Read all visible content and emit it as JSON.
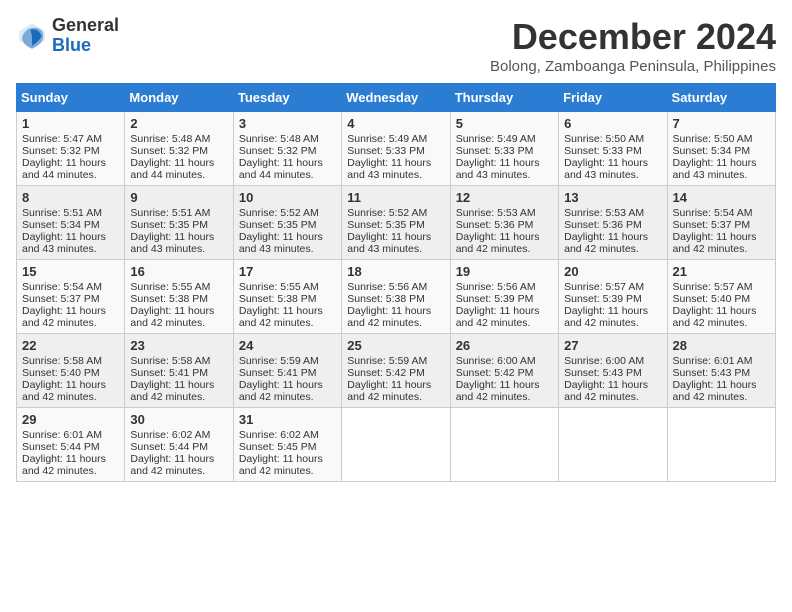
{
  "logo": {
    "general": "General",
    "blue": "Blue"
  },
  "title": "December 2024",
  "location": "Bolong, Zamboanga Peninsula, Philippines",
  "days_header": [
    "Sunday",
    "Monday",
    "Tuesday",
    "Wednesday",
    "Thursday",
    "Friday",
    "Saturday"
  ],
  "weeks": [
    [
      {
        "day": "1",
        "sunrise": "Sunrise: 5:47 AM",
        "sunset": "Sunset: 5:32 PM",
        "daylight": "Daylight: 11 hours and 44 minutes."
      },
      {
        "day": "2",
        "sunrise": "Sunrise: 5:48 AM",
        "sunset": "Sunset: 5:32 PM",
        "daylight": "Daylight: 11 hours and 44 minutes."
      },
      {
        "day": "3",
        "sunrise": "Sunrise: 5:48 AM",
        "sunset": "Sunset: 5:32 PM",
        "daylight": "Daylight: 11 hours and 44 minutes."
      },
      {
        "day": "4",
        "sunrise": "Sunrise: 5:49 AM",
        "sunset": "Sunset: 5:33 PM",
        "daylight": "Daylight: 11 hours and 43 minutes."
      },
      {
        "day": "5",
        "sunrise": "Sunrise: 5:49 AM",
        "sunset": "Sunset: 5:33 PM",
        "daylight": "Daylight: 11 hours and 43 minutes."
      },
      {
        "day": "6",
        "sunrise": "Sunrise: 5:50 AM",
        "sunset": "Sunset: 5:33 PM",
        "daylight": "Daylight: 11 hours and 43 minutes."
      },
      {
        "day": "7",
        "sunrise": "Sunrise: 5:50 AM",
        "sunset": "Sunset: 5:34 PM",
        "daylight": "Daylight: 11 hours and 43 minutes."
      }
    ],
    [
      {
        "day": "8",
        "sunrise": "Sunrise: 5:51 AM",
        "sunset": "Sunset: 5:34 PM",
        "daylight": "Daylight: 11 hours and 43 minutes."
      },
      {
        "day": "9",
        "sunrise": "Sunrise: 5:51 AM",
        "sunset": "Sunset: 5:35 PM",
        "daylight": "Daylight: 11 hours and 43 minutes."
      },
      {
        "day": "10",
        "sunrise": "Sunrise: 5:52 AM",
        "sunset": "Sunset: 5:35 PM",
        "daylight": "Daylight: 11 hours and 43 minutes."
      },
      {
        "day": "11",
        "sunrise": "Sunrise: 5:52 AM",
        "sunset": "Sunset: 5:35 PM",
        "daylight": "Daylight: 11 hours and 43 minutes."
      },
      {
        "day": "12",
        "sunrise": "Sunrise: 5:53 AM",
        "sunset": "Sunset: 5:36 PM",
        "daylight": "Daylight: 11 hours and 42 minutes."
      },
      {
        "day": "13",
        "sunrise": "Sunrise: 5:53 AM",
        "sunset": "Sunset: 5:36 PM",
        "daylight": "Daylight: 11 hours and 42 minutes."
      },
      {
        "day": "14",
        "sunrise": "Sunrise: 5:54 AM",
        "sunset": "Sunset: 5:37 PM",
        "daylight": "Daylight: 11 hours and 42 minutes."
      }
    ],
    [
      {
        "day": "15",
        "sunrise": "Sunrise: 5:54 AM",
        "sunset": "Sunset: 5:37 PM",
        "daylight": "Daylight: 11 hours and 42 minutes."
      },
      {
        "day": "16",
        "sunrise": "Sunrise: 5:55 AM",
        "sunset": "Sunset: 5:38 PM",
        "daylight": "Daylight: 11 hours and 42 minutes."
      },
      {
        "day": "17",
        "sunrise": "Sunrise: 5:55 AM",
        "sunset": "Sunset: 5:38 PM",
        "daylight": "Daylight: 11 hours and 42 minutes."
      },
      {
        "day": "18",
        "sunrise": "Sunrise: 5:56 AM",
        "sunset": "Sunset: 5:38 PM",
        "daylight": "Daylight: 11 hours and 42 minutes."
      },
      {
        "day": "19",
        "sunrise": "Sunrise: 5:56 AM",
        "sunset": "Sunset: 5:39 PM",
        "daylight": "Daylight: 11 hours and 42 minutes."
      },
      {
        "day": "20",
        "sunrise": "Sunrise: 5:57 AM",
        "sunset": "Sunset: 5:39 PM",
        "daylight": "Daylight: 11 hours and 42 minutes."
      },
      {
        "day": "21",
        "sunrise": "Sunrise: 5:57 AM",
        "sunset": "Sunset: 5:40 PM",
        "daylight": "Daylight: 11 hours and 42 minutes."
      }
    ],
    [
      {
        "day": "22",
        "sunrise": "Sunrise: 5:58 AM",
        "sunset": "Sunset: 5:40 PM",
        "daylight": "Daylight: 11 hours and 42 minutes."
      },
      {
        "day": "23",
        "sunrise": "Sunrise: 5:58 AM",
        "sunset": "Sunset: 5:41 PM",
        "daylight": "Daylight: 11 hours and 42 minutes."
      },
      {
        "day": "24",
        "sunrise": "Sunrise: 5:59 AM",
        "sunset": "Sunset: 5:41 PM",
        "daylight": "Daylight: 11 hours and 42 minutes."
      },
      {
        "day": "25",
        "sunrise": "Sunrise: 5:59 AM",
        "sunset": "Sunset: 5:42 PM",
        "daylight": "Daylight: 11 hours and 42 minutes."
      },
      {
        "day": "26",
        "sunrise": "Sunrise: 6:00 AM",
        "sunset": "Sunset: 5:42 PM",
        "daylight": "Daylight: 11 hours and 42 minutes."
      },
      {
        "day": "27",
        "sunrise": "Sunrise: 6:00 AM",
        "sunset": "Sunset: 5:43 PM",
        "daylight": "Daylight: 11 hours and 42 minutes."
      },
      {
        "day": "28",
        "sunrise": "Sunrise: 6:01 AM",
        "sunset": "Sunset: 5:43 PM",
        "daylight": "Daylight: 11 hours and 42 minutes."
      }
    ],
    [
      {
        "day": "29",
        "sunrise": "Sunrise: 6:01 AM",
        "sunset": "Sunset: 5:44 PM",
        "daylight": "Daylight: 11 hours and 42 minutes."
      },
      {
        "day": "30",
        "sunrise": "Sunrise: 6:02 AM",
        "sunset": "Sunset: 5:44 PM",
        "daylight": "Daylight: 11 hours and 42 minutes."
      },
      {
        "day": "31",
        "sunrise": "Sunrise: 6:02 AM",
        "sunset": "Sunset: 5:45 PM",
        "daylight": "Daylight: 11 hours and 42 minutes."
      },
      null,
      null,
      null,
      null
    ]
  ]
}
